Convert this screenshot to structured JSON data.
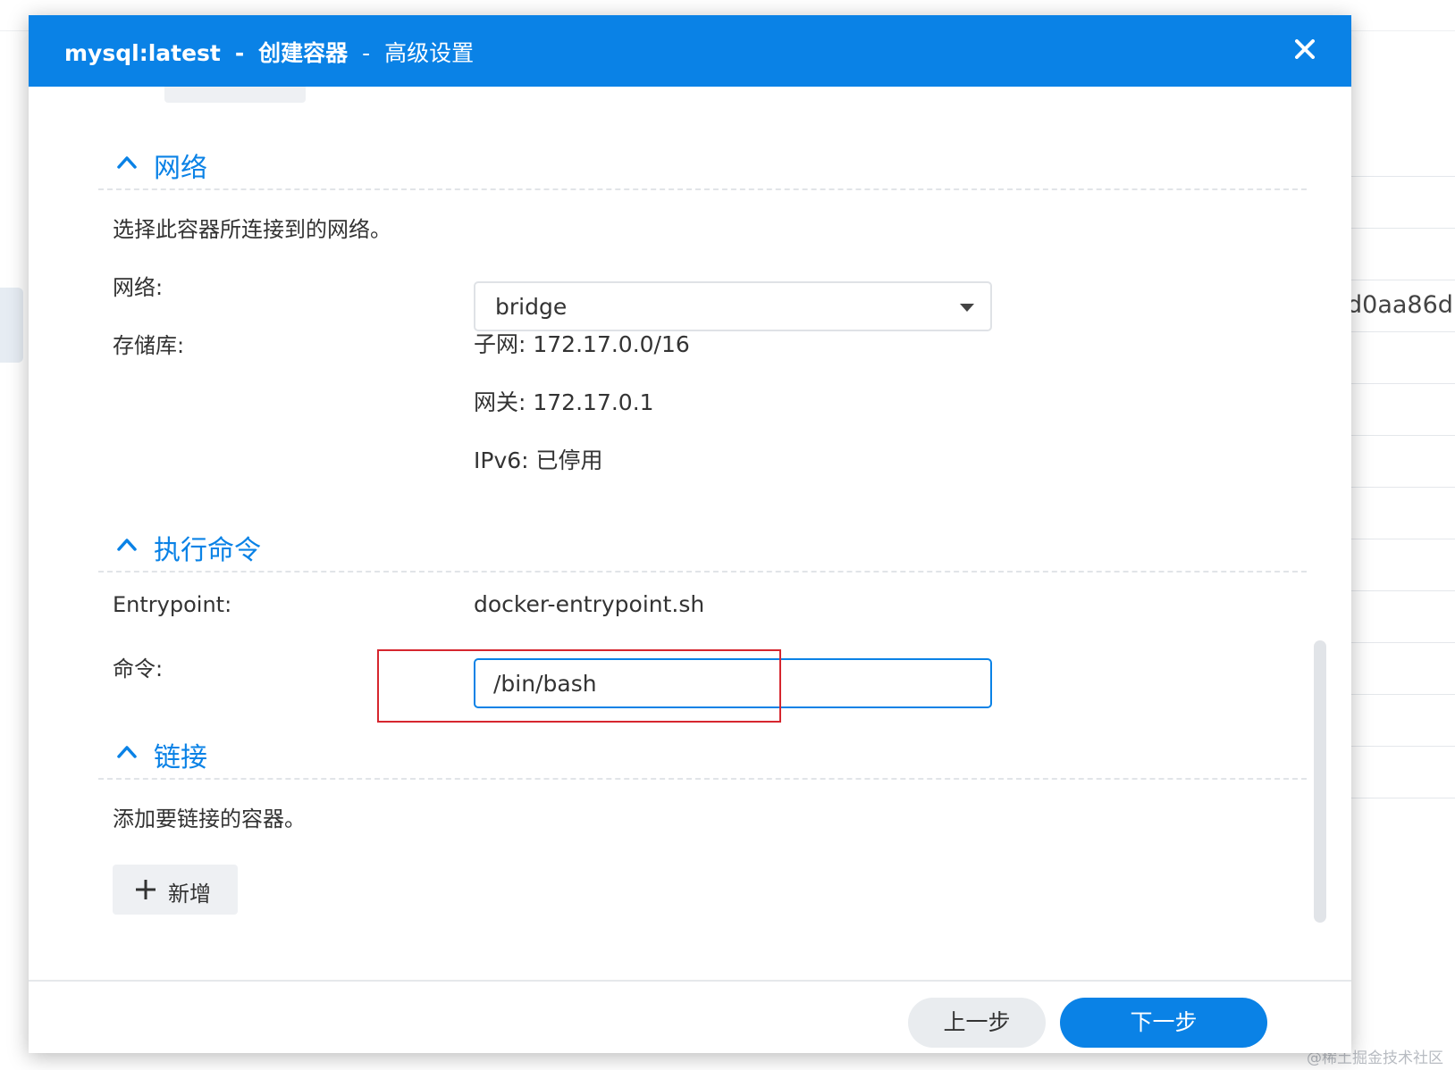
{
  "dialog": {
    "app_name": "mysql:latest",
    "title_sep": "-",
    "step_title": "创建容器",
    "subtitle": "高级设置",
    "close_icon": "close-icon",
    "accent": "#0a82e6"
  },
  "background": {
    "container_id_fragment": "d0aa86d",
    "watermark": "@稀土掘金技术社区"
  },
  "network": {
    "section_title": "网络",
    "description": "选择此容器所连接到的网络。",
    "network_label": "网络:",
    "network_value": "bridge",
    "storage_label": "存储库:",
    "subnet": "子网: 172.17.0.0/16",
    "gateway": "网关: 172.17.0.1",
    "ipv6": "IPv6: 已停用"
  },
  "exec": {
    "section_title": "执行命令",
    "entrypoint_label": "Entrypoint:",
    "entrypoint_value": "docker-entrypoint.sh",
    "command_label": "命令:",
    "command_value": "/bin/bash",
    "highlight_color": "#d6262e"
  },
  "links": {
    "section_title": "链接",
    "description": "添加要链接的容器。",
    "add_label": "新增"
  },
  "footer": {
    "prev_label": "上一步",
    "next_label": "下一步"
  }
}
